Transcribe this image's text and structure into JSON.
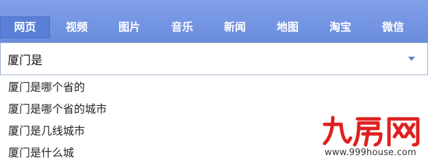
{
  "tabs": [
    {
      "label": "网页",
      "active": true
    },
    {
      "label": "视频",
      "active": false
    },
    {
      "label": "图片",
      "active": false
    },
    {
      "label": "音乐",
      "active": false
    },
    {
      "label": "新闻",
      "active": false
    },
    {
      "label": "地图",
      "active": false
    },
    {
      "label": "淘宝",
      "active": false
    },
    {
      "label": "微信",
      "active": false
    }
  ],
  "search": {
    "value": "厦门是",
    "placeholder": ""
  },
  "suggestions": [
    "厦门是哪个省的",
    "厦门是哪个省的城市",
    "厦门是几线城市",
    "厦门是什么城"
  ],
  "watermark": {
    "logo_text": "九房网",
    "url": "www.999house.com",
    "color": "#e02020"
  },
  "colors": {
    "tabbar": "#7394e2",
    "active_tab": "#5a7fd6"
  },
  "icons": {
    "dropdown": "chevron-down-icon"
  }
}
